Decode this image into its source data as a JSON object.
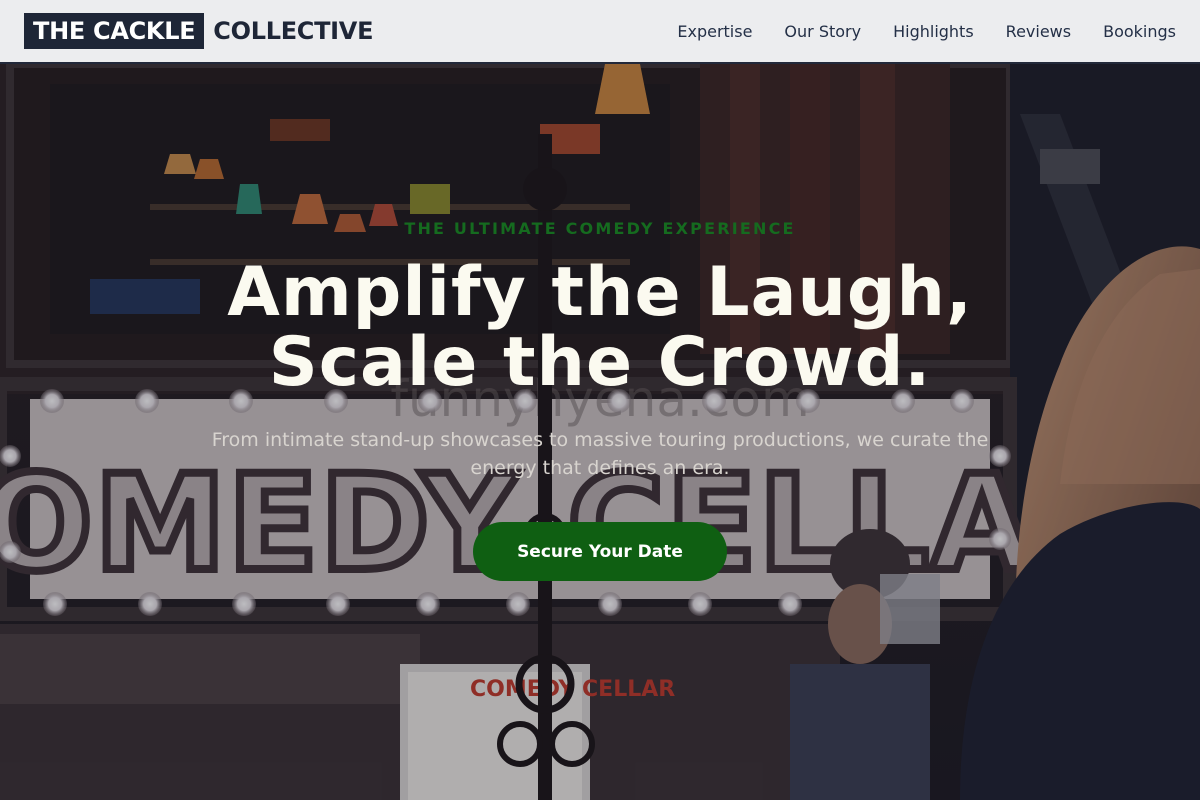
{
  "brand": {
    "logo_boxed": "THE CACKLE",
    "logo_rest": "COLLECTIVE"
  },
  "nav": {
    "items": [
      {
        "label": "Expertise"
      },
      {
        "label": "Our Story"
      },
      {
        "label": "Highlights"
      },
      {
        "label": "Reviews"
      },
      {
        "label": "Bookings"
      }
    ]
  },
  "hero": {
    "eyebrow": "THE ULTIMATE COMEDY EXPERIENCE",
    "headline_line1": "Amplify the Laugh,",
    "headline_line2": "Scale the Crowd.",
    "subtext": "From intimate stand-up showcases to massive touring productions, we curate the energy that defines an era.",
    "cta_label": "Secure Your Date",
    "background": {
      "sign_text": "COMEDY CELLAR",
      "watermark_text": "funnyhyena.com",
      "poster_text": "COMEDY CELLAR"
    }
  },
  "colors": {
    "header_bg": "#ecedef",
    "brand_dark": "#1e2637",
    "eyebrow_green": "#156b1f",
    "cta_green": "#0f5f12",
    "headline_text": "#fbfaf0"
  }
}
